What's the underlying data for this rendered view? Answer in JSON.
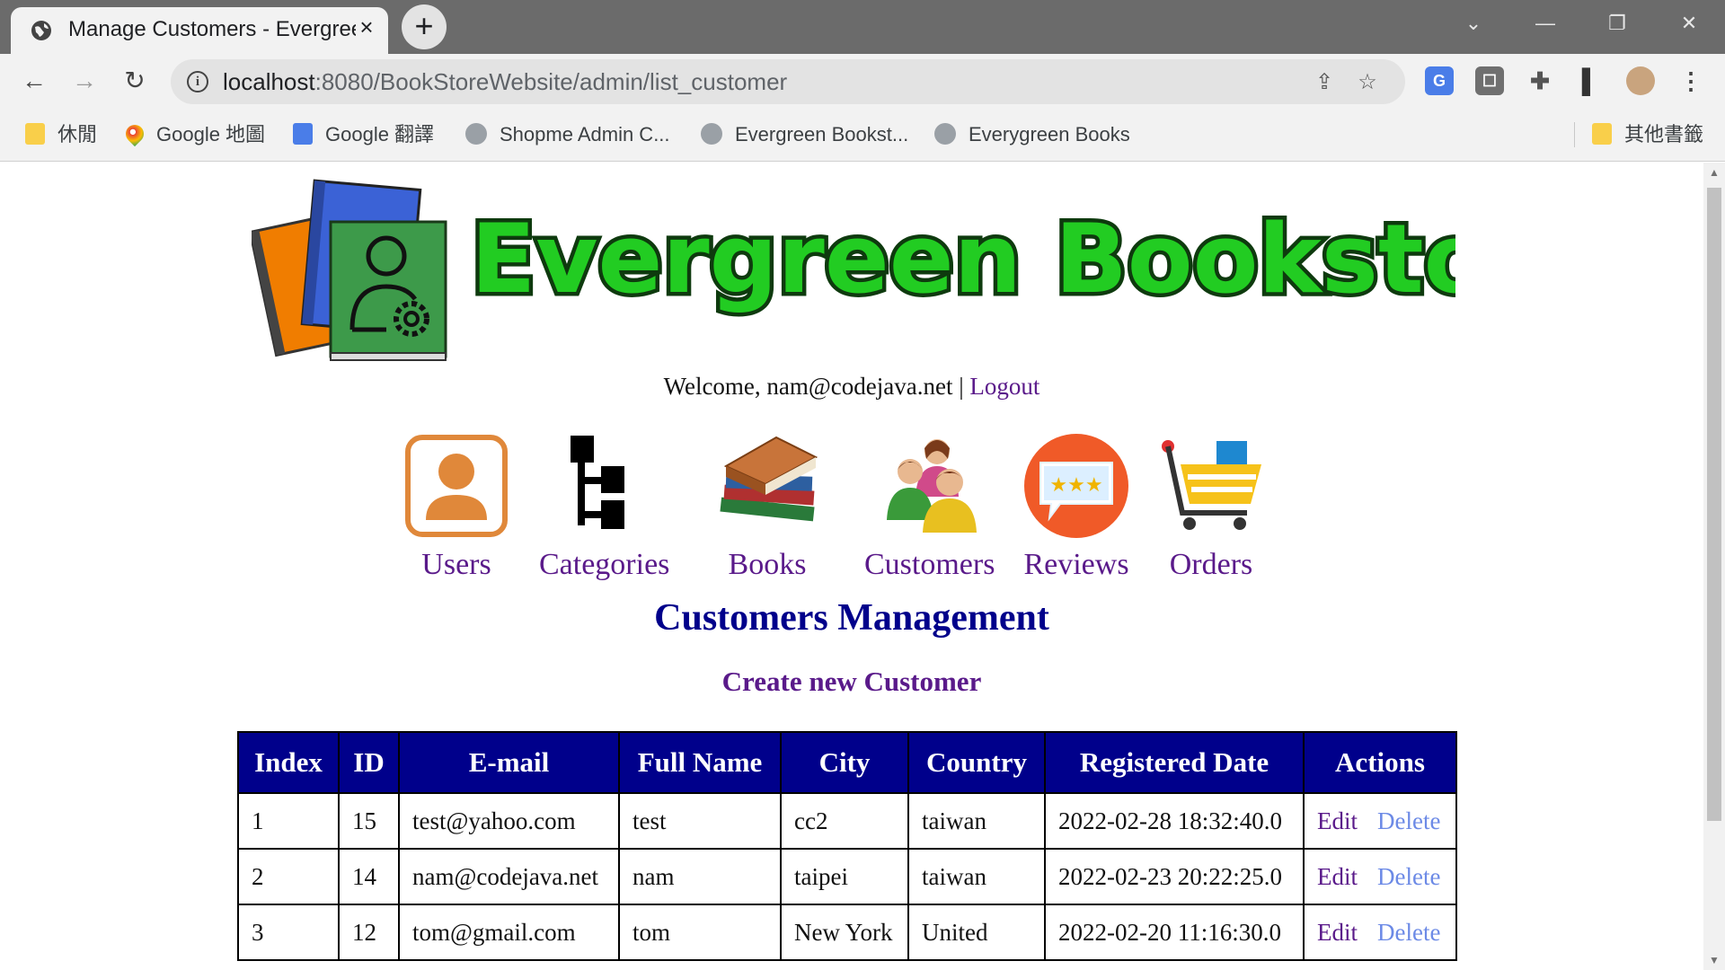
{
  "browser": {
    "tab_title": "Manage Customers - Evergreen",
    "tab_close": "×",
    "new_tab": "+",
    "url_host": "localhost",
    "url_rest": ":8080/BookStoreWebsite/admin/list_customer",
    "bookmarks": [
      {
        "label": "休閒",
        "icon": "folder-icon"
      },
      {
        "label": "Google 地圖",
        "icon": "maps-icon"
      },
      {
        "label": "Google 翻譯",
        "icon": "translate-icon"
      },
      {
        "label": "Shopme Admin C...",
        "icon": "globe-icon"
      },
      {
        "label": "Evergreen Bookst...",
        "icon": "globe-icon"
      },
      {
        "label": "Everygreen Books",
        "icon": "globe-icon"
      }
    ],
    "other_bookmarks": "其他書籤"
  },
  "site": {
    "logo_text": "Evergreen Bookstore",
    "welcome_text": "Welcome, nam@codejava.net",
    "separator": "|",
    "logout": "Logout"
  },
  "menu": [
    {
      "label": "Users",
      "icon": "users-icon"
    },
    {
      "label": "Categories",
      "icon": "categories-icon"
    },
    {
      "label": "Books",
      "icon": "books-icon"
    },
    {
      "label": "Customers",
      "icon": "customers-icon"
    },
    {
      "label": "Reviews",
      "icon": "reviews-icon"
    },
    {
      "label": "Orders",
      "icon": "orders-icon"
    }
  ],
  "main": {
    "title": "Customers Management",
    "create_link": "Create new Customer",
    "table": {
      "headers": [
        "Index",
        "ID",
        "E-mail",
        "Full Name",
        "City",
        "Country",
        "Registered Date",
        "Actions"
      ],
      "rows": [
        {
          "index": "1",
          "id": "15",
          "email": "test@yahoo.com",
          "name": "test",
          "city": "cc2",
          "country": "taiwan",
          "date": "2022-02-28 18:32:40.0"
        },
        {
          "index": "2",
          "id": "14",
          "email": "nam@codejava.net",
          "name": "nam",
          "city": "taipei",
          "country": "taiwan",
          "date": "2022-02-23 20:22:25.0"
        },
        {
          "index": "3",
          "id": "12",
          "email": "tom@gmail.com",
          "name": "tom",
          "city": "New York",
          "country": "United",
          "date": "2022-02-20 11:16:30.0"
        }
      ],
      "edit_label": "Edit",
      "delete_label": "Delete"
    }
  },
  "colors": {
    "header_bg": "#00008b",
    "link": "#5a1a8a",
    "delete_link": "#6c8ae6",
    "logo_green": "#22cc22"
  }
}
